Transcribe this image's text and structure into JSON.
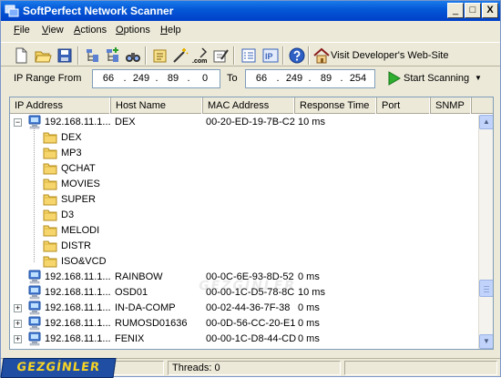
{
  "window": {
    "title": "SoftPerfect Network Scanner",
    "controls": [
      "_",
      "□",
      "X"
    ]
  },
  "menu": [
    {
      "label": "File",
      "underline": "F",
      "rest": "ile"
    },
    {
      "label": "View",
      "underline": "V",
      "rest": "iew"
    },
    {
      "label": "Actions",
      "underline": "A",
      "rest": "ctions"
    },
    {
      "label": "Options",
      "underline": "O",
      "rest": "ptions"
    },
    {
      "label": "Help",
      "underline": "H",
      "rest": "elp"
    }
  ],
  "toolbar": {
    "visit_label": "Visit Developer's Web-Site",
    "buttons": [
      "new-icon",
      "open-icon",
      "save-icon",
      "tree-collapse-icon",
      "tree-expand-icon",
      "binoculars-icon",
      "properties-icon",
      "wand-icon",
      "dotcom-icon",
      "tools-icon",
      "list-icon",
      "ip-icon",
      "help-icon",
      "home-icon"
    ],
    "ip_button_label": "IP",
    "dotcom_label": ".com"
  },
  "ip_range": {
    "from_label": "IP Range From",
    "to_label": "To",
    "from": [
      "66",
      "249",
      "89",
      "0"
    ],
    "to": [
      "66",
      "249",
      "89",
      "254"
    ],
    "start_label": "Start Scanning"
  },
  "columns": [
    "IP Address",
    "Host Name",
    "MAC Address",
    "Response Time",
    "Port",
    "SNMP"
  ],
  "rows": [
    {
      "type": "host",
      "expander": "−",
      "ip": "192.168.11.1...",
      "host": "DEX",
      "mac": "00-20-ED-19-7B-C2",
      "time": "10 ms"
    },
    {
      "type": "share",
      "name": "DEX"
    },
    {
      "type": "share",
      "name": "MP3"
    },
    {
      "type": "share",
      "name": "QCHAT"
    },
    {
      "type": "share",
      "name": "MOVIES"
    },
    {
      "type": "share",
      "name": "SUPER"
    },
    {
      "type": "share",
      "name": "D3"
    },
    {
      "type": "share",
      "name": "MELODI"
    },
    {
      "type": "share",
      "name": "DISTR"
    },
    {
      "type": "share",
      "name": "ISO&VCD"
    },
    {
      "type": "host",
      "expander": "",
      "ip": "192.168.11.1...",
      "host": "RAINBOW",
      "mac": "00-0C-6E-93-8D-52",
      "time": "0 ms"
    },
    {
      "type": "host",
      "expander": "",
      "ip": "192.168.11.1...",
      "host": "OSD01",
      "mac": "00-00-1C-D5-78-8C",
      "time": "10 ms"
    },
    {
      "type": "host",
      "expander": "+",
      "ip": "192.168.11.1...",
      "host": "IN-DA-COMP",
      "mac": "00-02-44-36-7F-38",
      "time": "0 ms"
    },
    {
      "type": "host",
      "expander": "+",
      "ip": "192.168.11.1...",
      "host": "RUMOSD01636",
      "mac": "00-0D-56-CC-20-E1",
      "time": "0 ms"
    },
    {
      "type": "host",
      "expander": "+",
      "ip": "192.168.11.1...",
      "host": "FENIX",
      "mac": "00-00-1C-D8-44-CD",
      "time": "0 ms"
    }
  ],
  "status": {
    "threads": "Threads: 0"
  },
  "watermark": "GEZGİNLER",
  "logo": "GEZGİNLER"
}
